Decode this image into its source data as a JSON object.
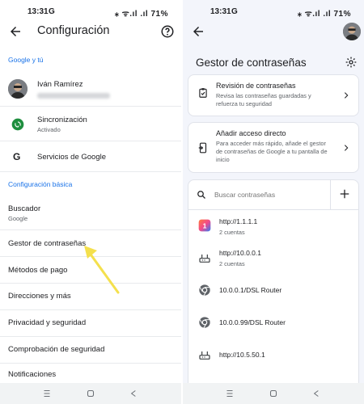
{
  "left": {
    "status": {
      "time": "13:31",
      "g": "G",
      "icons": "⁎ ᯤ.ıl .ıl 71%"
    },
    "title": "Configuración",
    "sections": {
      "google": "Google y tú",
      "basic": "Configuración básica"
    },
    "account": {
      "name": "Iván Ramírez"
    },
    "sync": {
      "label": "Sincronización",
      "sub": "Activado"
    },
    "google_services": "Servicios de Google",
    "search_engine": {
      "label": "Buscador",
      "sub": "Google"
    },
    "items": [
      "Gestor de contraseñas",
      "Métodos de pago",
      "Direcciones y más",
      "Privacidad y seguridad",
      "Comprobación de seguridad",
      "Notificaciones"
    ]
  },
  "right": {
    "status": {
      "time": "13:31",
      "g": "G",
      "icons": "⁎ ᯤ.ıl .ıl 71%"
    },
    "title": "Gestor de contraseñas",
    "review": {
      "title": "Revisión de contraseñas",
      "desc": "Revisa las contraseñas guardadas y refuerza tu seguridad"
    },
    "shortcut": {
      "title": "Añadir acceso directo",
      "desc": "Para acceder más rápido, añade el gestor de contraseñas de Google a tu pantalla de inicio"
    },
    "search": {
      "placeholder": "Buscar contraseñas"
    },
    "entries": [
      {
        "site": "http://1.1.1.1",
        "count": "2 cuentas",
        "icon": "app-icon"
      },
      {
        "site": "http://10.0.0.1",
        "count": "2 cuentas",
        "icon": "router-icon"
      },
      {
        "site": "10.0.0.1/DSL Router",
        "count": "",
        "icon": "chrome-icon"
      },
      {
        "site": "10.0.0.99/DSL Router",
        "count": "",
        "icon": "chrome-icon"
      },
      {
        "site": "http://10.5.50.1",
        "count": "",
        "icon": "router-icon"
      }
    ]
  },
  "colors": {
    "accent": "#1a73e8",
    "annotation": "#f4e04d",
    "sync_green": "#1e8e3e"
  }
}
